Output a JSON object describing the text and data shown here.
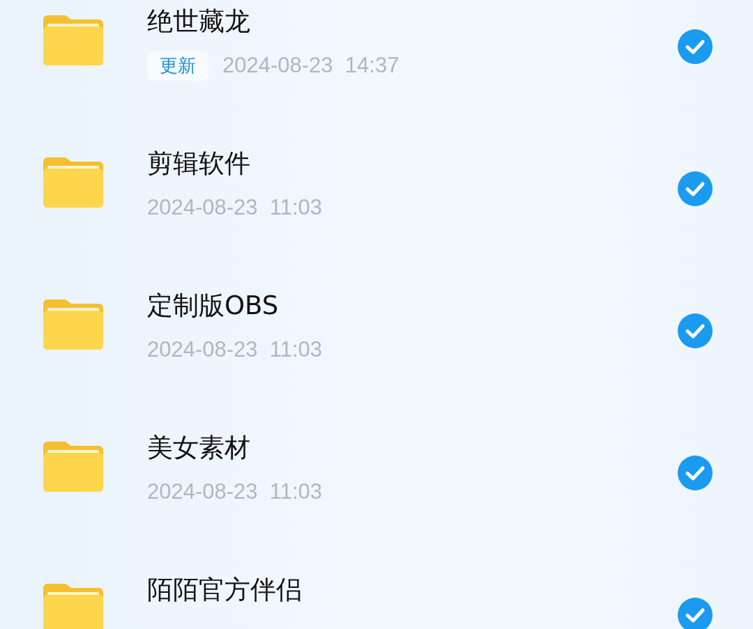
{
  "files": [
    {
      "name": "绝世藏龙",
      "badge": "更新",
      "date": "2024-08-23  14:37",
      "checked": true
    },
    {
      "name": "剪辑软件",
      "date": "2024-08-23  11:03",
      "checked": true
    },
    {
      "name": "定制版OBS",
      "date": "2024-08-23  11:03",
      "checked": true
    },
    {
      "name": "美女素材",
      "date": "2024-08-23  11:03",
      "checked": true
    },
    {
      "name": "陌陌官方伴侣",
      "checked": true
    }
  ]
}
